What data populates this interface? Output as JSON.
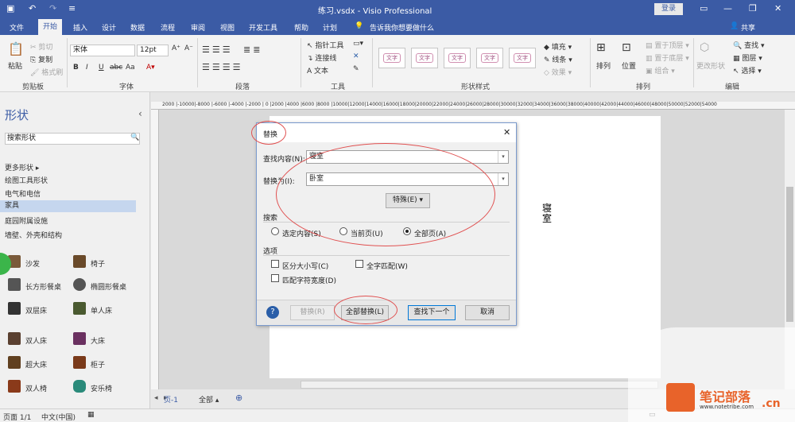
{
  "window": {
    "title": "练习.vsdx - Visio Professional",
    "login_label": "登录"
  },
  "menu": {
    "items": [
      "文件",
      "开始",
      "插入",
      "设计",
      "数据",
      "流程",
      "审阅",
      "视图",
      "开发工具",
      "帮助",
      "计划"
    ],
    "active": "开始",
    "tell_me": "告诉我你想要做什么",
    "share": "共享"
  },
  "ribbon": {
    "clipboard": {
      "paste": "粘贴",
      "cut": "剪切",
      "copy": "复制",
      "format_painter": "格式刷",
      "label": "剪贴板"
    },
    "font": {
      "family": "宋体",
      "size": "12pt",
      "label": "字体"
    },
    "paragraph": {
      "label": "段落"
    },
    "tools": {
      "pointer": "指针工具",
      "connector": "连接线",
      "text": "文本",
      "label": "工具"
    },
    "shape_styles": {
      "sample": "文字",
      "fill": "填充",
      "line": "线条",
      "effects": "效果",
      "label": "形状样式"
    },
    "arrange": {
      "align": "排列",
      "position": "位置",
      "bring_front": "置于顶层",
      "send_back": "置于底层",
      "group": "组合",
      "label": "排列"
    },
    "editing": {
      "change_shape": "更改形状",
      "find": "查找",
      "layers": "图层",
      "select": "选择",
      "label": "编辑"
    }
  },
  "shapes_panel": {
    "title": "形状",
    "search_placeholder": "搜索形状",
    "categories": [
      "更多形状",
      "绘图工具形状",
      "电气和电信",
      "家具",
      "庭园附属设施",
      "墙壁、外壳和结构"
    ],
    "selected_category": "家具",
    "stencils": [
      "沙发",
      "椅子",
      "长方形餐桌",
      "椭圆形餐桌",
      "双层床",
      "单人床",
      "双人床",
      "大床",
      "超大床",
      "柜子",
      "双人椅",
      "安乐椅"
    ]
  },
  "ruler": {
    "ticks": "2000 |-10000|-8000 |-6000 |-4000 |-2000 | 0 |2000 |4000 |6000 |8000 |10000|12000|14000|16000|18000|20000|22000|24000|26000|28000|30000|32000|34000|36000|38000|40000|42000|44000|46000|48000|50000|52000|54000"
  },
  "canvas": {
    "page_text": "寝室"
  },
  "tabs": {
    "page_tab": "页-1",
    "all_tab": "全部 ▴"
  },
  "status": {
    "page": "页面 1/1",
    "language": "中文(中国)"
  },
  "dialog": {
    "title": "替换",
    "find_label": "查找内容(N):",
    "find_value": "寝室",
    "replace_label": "替换为(I):",
    "replace_value": "卧室",
    "special_button": "特殊(E) ▾",
    "search_label": "搜索",
    "radio_selection": "选定内容(S)",
    "radio_page": "当前页(U)",
    "radio_all": "全部页(A)",
    "options_label": "选项",
    "opt_case": "区分大小写(C)",
    "opt_whole": "全字匹配(W)",
    "opt_width": "匹配字符宽度(D)",
    "btn_replace": "替换(R)",
    "btn_replace_all": "全部替换(L)",
    "btn_find_next": "查找下一个",
    "btn_cancel": "取消"
  },
  "watermark": {
    "brand": "笔记部落",
    "url": "www.notetribe.com",
    "suffix": ".cn"
  },
  "colors": {
    "accent": "#3b5ba5",
    "annotation": "#e05050"
  }
}
